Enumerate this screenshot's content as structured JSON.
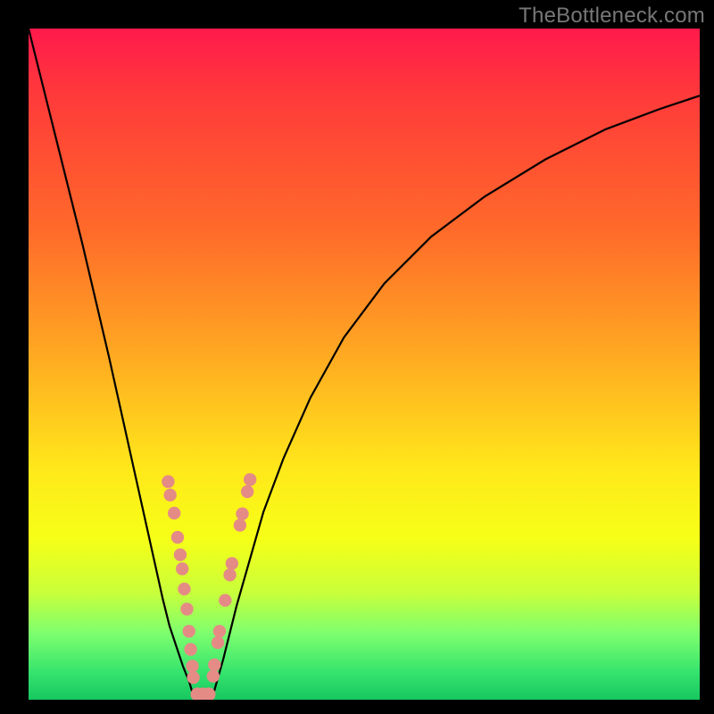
{
  "watermark": "TheBottleneck.com",
  "colors": {
    "dot": "#e58b86",
    "curve": "#000000",
    "frame": "#000000"
  },
  "chart_data": {
    "type": "line",
    "title": "",
    "xlabel": "",
    "ylabel": "",
    "xlim": [
      0,
      100
    ],
    "ylim": [
      0,
      100
    ],
    "series": [
      {
        "name": "left-branch",
        "x": [
          0,
          2,
          4,
          6,
          8,
          10,
          12,
          14,
          16,
          18,
          20,
          21,
          22,
          23,
          24,
          24.7
        ],
        "y": [
          100,
          92,
          84,
          76,
          68,
          59.5,
          51,
          42,
          33,
          24,
          15,
          11,
          8,
          5,
          2.5,
          0
        ]
      },
      {
        "name": "right-branch",
        "x": [
          27.3,
          28,
          29,
          30,
          31,
          33,
          35,
          38,
          42,
          47,
          53,
          60,
          68,
          77,
          86,
          94,
          100
        ],
        "y": [
          0,
          2.5,
          6,
          10,
          14,
          21,
          28,
          36,
          45,
          54,
          62,
          69,
          75,
          80.5,
          85,
          88,
          90
        ]
      }
    ],
    "flat_segment": {
      "x0": 24.7,
      "x1": 27.3,
      "y": 0
    },
    "markers_left": [
      {
        "x": 20.8,
        "y": 32.5
      },
      {
        "x": 21.1,
        "y": 30.5
      },
      {
        "x": 21.7,
        "y": 27.8
      },
      {
        "x": 22.2,
        "y": 24.2
      },
      {
        "x": 22.6,
        "y": 21.6
      },
      {
        "x": 22.9,
        "y": 19.5
      },
      {
        "x": 23.2,
        "y": 16.5
      },
      {
        "x": 23.6,
        "y": 13.5
      },
      {
        "x": 23.9,
        "y": 10.2
      },
      {
        "x": 24.15,
        "y": 7.5
      },
      {
        "x": 24.4,
        "y": 5.0
      },
      {
        "x": 24.55,
        "y": 3.3
      }
    ],
    "markers_right": [
      {
        "x": 27.5,
        "y": 3.5
      },
      {
        "x": 27.7,
        "y": 5.2
      },
      {
        "x": 28.2,
        "y": 8.5
      },
      {
        "x": 28.45,
        "y": 10.2
      },
      {
        "x": 29.3,
        "y": 14.8
      },
      {
        "x": 30.0,
        "y": 18.6
      },
      {
        "x": 30.3,
        "y": 20.3
      },
      {
        "x": 31.5,
        "y": 26.0
      },
      {
        "x": 31.85,
        "y": 27.7
      },
      {
        "x": 32.6,
        "y": 31.0
      },
      {
        "x": 33.0,
        "y": 32.8
      }
    ],
    "bottom_pill": [
      {
        "x": 25.15,
        "y": 0.8
      },
      {
        "x": 26.0,
        "y": 0.8
      },
      {
        "x": 26.85,
        "y": 0.8
      }
    ]
  }
}
